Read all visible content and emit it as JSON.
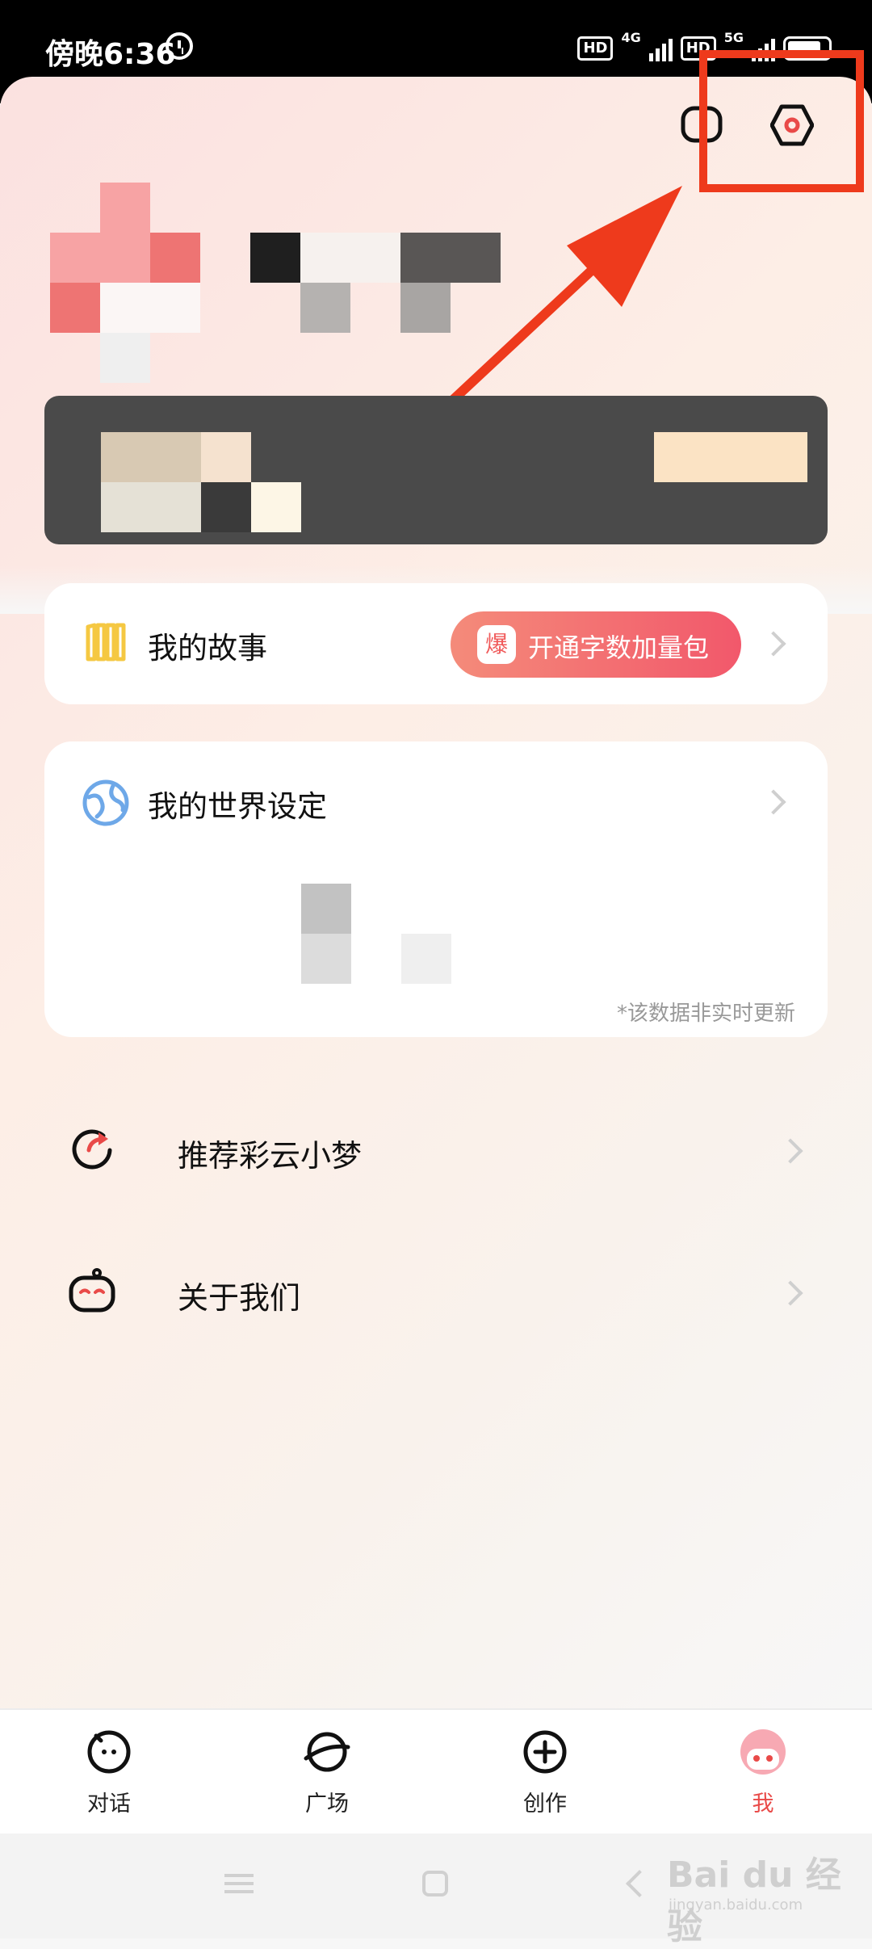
{
  "status_bar": {
    "time": "傍晚6:36",
    "network1": "4G",
    "network2": "5G",
    "hd": "HD"
  },
  "header": {
    "message_icon": "message-icon",
    "settings_icon": "settings-hexagon-icon",
    "highlight_color": "#ee3a1c"
  },
  "story_card": {
    "title": "我的故事",
    "promo_badge": "爆",
    "promo_label": "开通字数加量包"
  },
  "world_card": {
    "title": "我的世界设定",
    "note": "*该数据非实时更新"
  },
  "menu": [
    {
      "label": "推荐彩云小梦",
      "icon": "share-icon"
    },
    {
      "label": "关于我们",
      "icon": "robot-icon"
    }
  ],
  "bottom_nav": [
    {
      "label": "对话",
      "icon": "chat-icon",
      "active": false
    },
    {
      "label": "广场",
      "icon": "plaza-icon",
      "active": false
    },
    {
      "label": "创作",
      "icon": "create-plus-icon",
      "active": false
    },
    {
      "label": "我",
      "icon": "avatar-icon",
      "active": true
    }
  ],
  "watermark": {
    "text": "Bai du 经验",
    "sub": "jingyan.baidu.com"
  }
}
